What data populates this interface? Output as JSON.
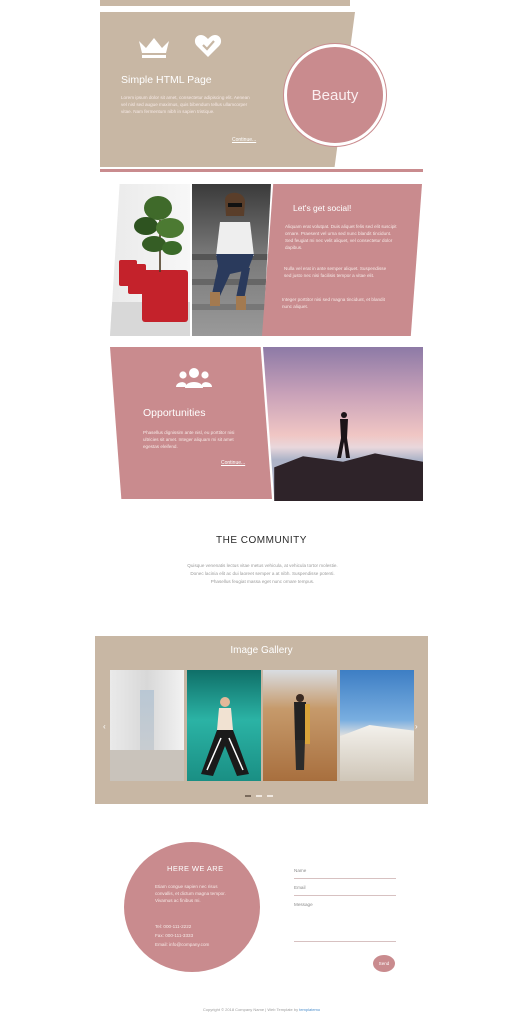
{
  "hero": {
    "title": "Simple HTML Page",
    "text": "Lorem ipsum dolor sit amet, consectetur adipiscing elit. Aenean vel nisl sed augue maximus, quis bibendum tellus ullamcorper vitae. Nam fermentum nibh in sapien tristique.",
    "continue": "Continue...",
    "badge": "Beauty"
  },
  "social": {
    "title": "Let's get social!",
    "p1": "Aliquam erat volutpat. Duis aliquet felis sed elit suscipit ornare. Praesent vel urna sed nunc blandit tincidunt. Sed feugiat mi nec velit aliquet, vel consectetur dolor dapibus.",
    "p2": "Nulla vel erat in ante semper aliquet. Suspendisse sed justo nec nisi facilisis tempor a vitae elit.",
    "p3": "Integer porttitor nisi sed magna tincidunt, et blandit nunc aliquet."
  },
  "opportunities": {
    "title": "Opportunities",
    "text": "Phasellus dignissim ante nisl, eu porttitor nisi ultricies sit amet. Integer aliquam mi sit amet egestas eleifend.",
    "continue": "Continue..."
  },
  "community": {
    "title": "THE COMMUNITY",
    "text": "Quisque venenatis lectus vitae metus vehicula, at vehicula tortor molestie. Donec lacinia elit ac dui laoreet semper a at nibh. Suspendisse potenti. Phasellus feugiat massa eget nunc ornare tempus."
  },
  "gallery": {
    "title": "Image Gallery",
    "prev": "‹",
    "next": "›"
  },
  "contact": {
    "title": "HERE WE ARE",
    "text": "Etiam congue sapien nec risus convallis, et dictum magna tempor. Vivamus ac finibus mi.",
    "phone": "Tel: 000-111-2222",
    "fax": "Fax: 000-111-3333",
    "email": "Email: info@company.com",
    "name_label": "Name",
    "email_label": "Email",
    "message_label": "Message",
    "send": "Send"
  },
  "footer": {
    "text": "Copyright © 2018 Company Name | Web Template by",
    "link": "templatemo"
  }
}
